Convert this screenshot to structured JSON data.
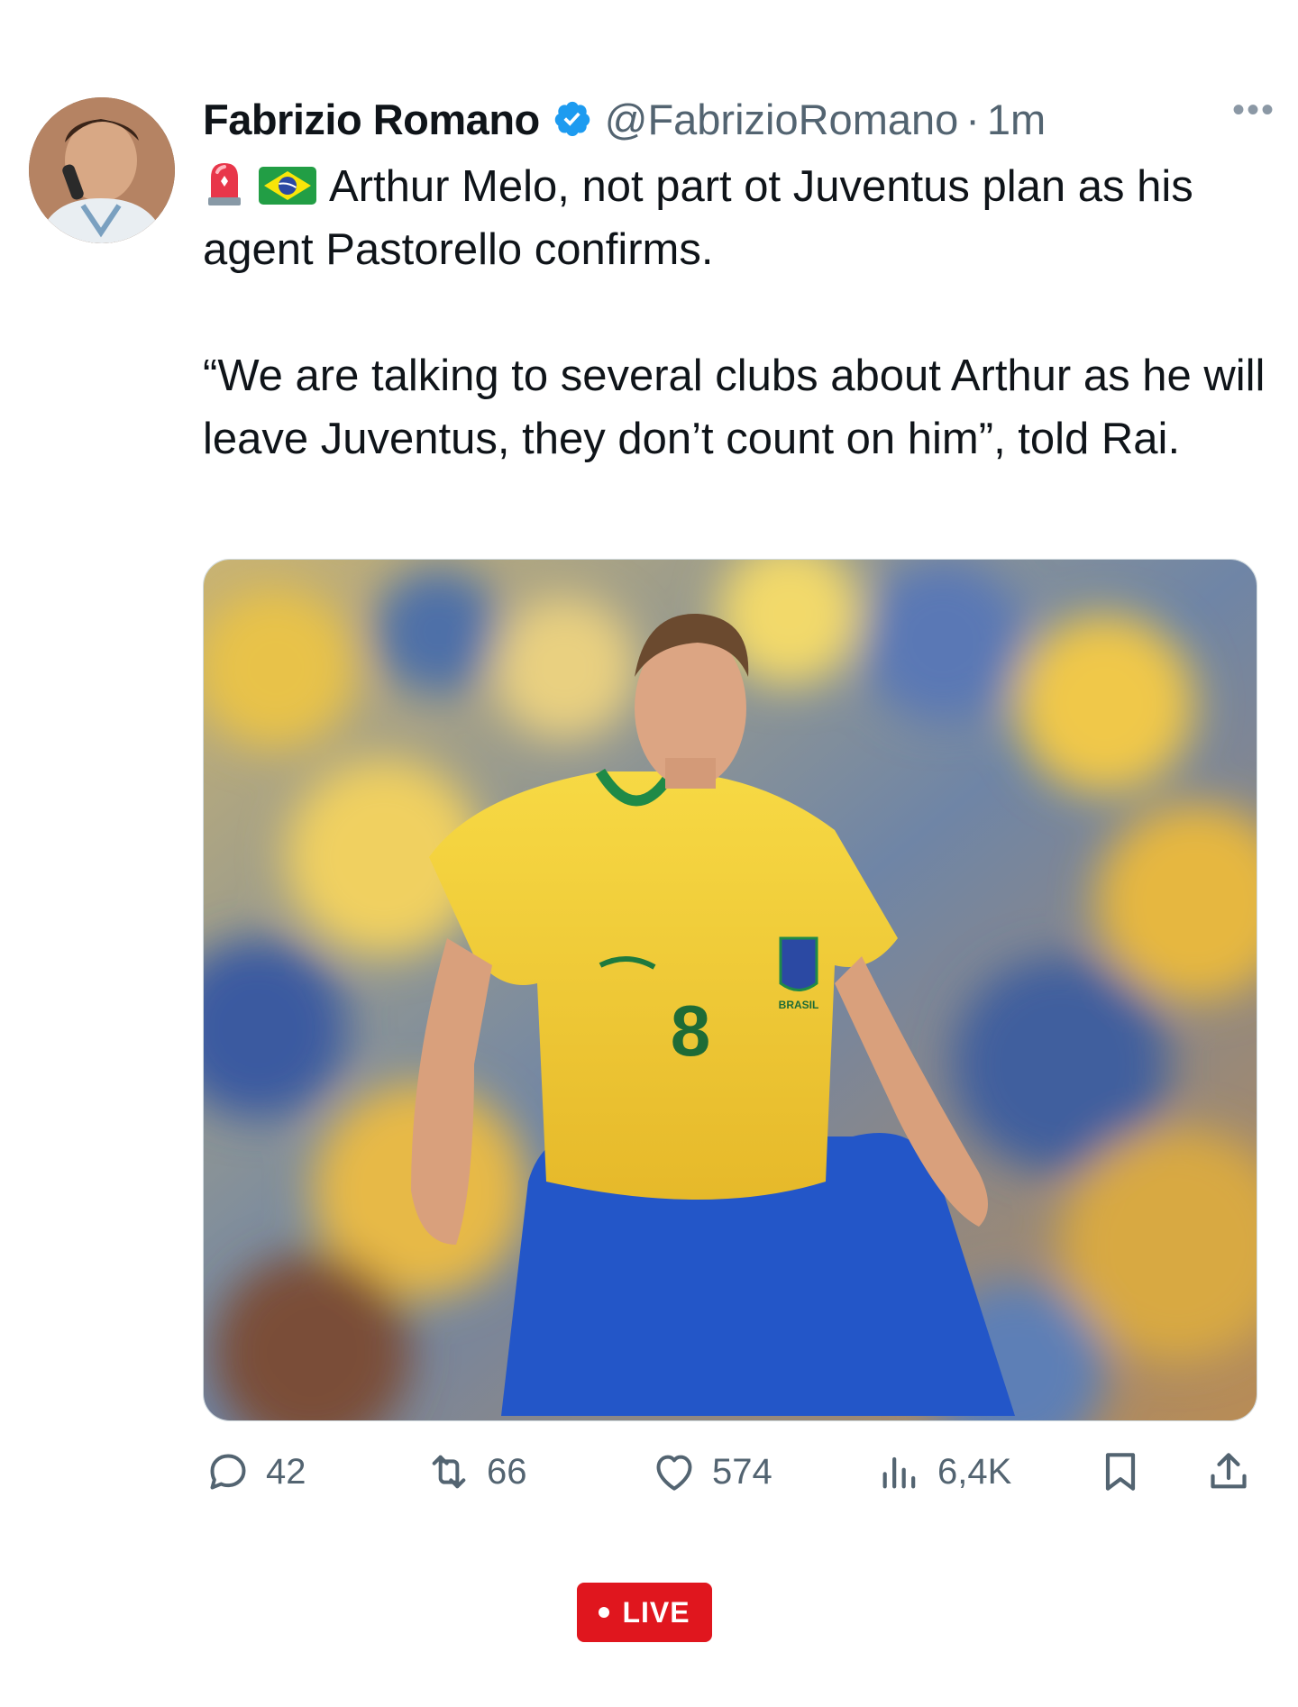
{
  "author": {
    "name": "Fabrizio Romano",
    "handle": "@FabrizioRomano",
    "separator": "·",
    "time": "1m",
    "verified": true
  },
  "tweet": {
    "line1": "Arthur Melo, not part ot Juventus plan as his agent Pastorello confirms.",
    "quote": "“We are talking to several clubs about Arthur as he will leave Juventus, they don’t count on him”, told Rai."
  },
  "media": {
    "jersey_number": "8",
    "jersey_crest_text": "BRASIL"
  },
  "actions": {
    "replies": "42",
    "reposts": "66",
    "likes": "574",
    "views": "6,4K"
  },
  "live_badge": {
    "label": "LIVE"
  },
  "colors": {
    "text": "#0f1419",
    "muted": "#536471",
    "verified": "#1d9bf0",
    "live": "#e0161e",
    "jersey_yellow": "#f4d33a",
    "shorts_blue": "#2356c8"
  },
  "icons": [
    "more-icon",
    "verified-icon",
    "siren-emoji",
    "brazil-flag-emoji",
    "reply-icon",
    "repost-icon",
    "like-icon",
    "views-icon",
    "bookmark-icon",
    "share-icon"
  ]
}
